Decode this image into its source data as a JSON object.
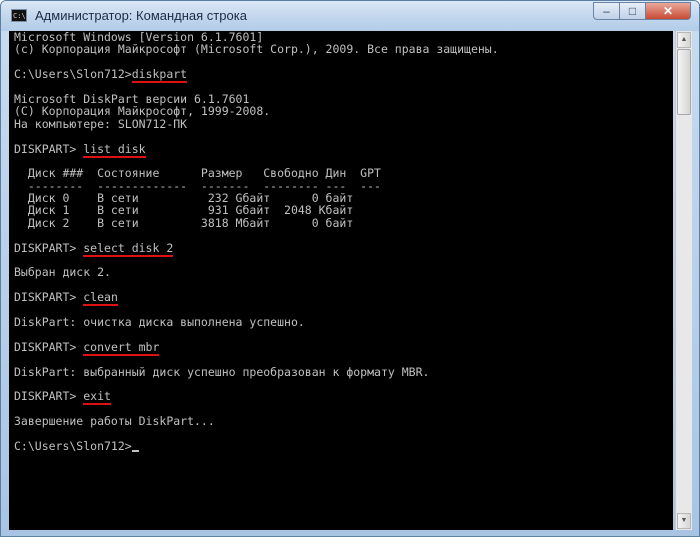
{
  "window": {
    "icon_text": "C:\\",
    "title": "Администратор: Командная строка",
    "minimize_glyph": "–",
    "maximize_glyph": "□",
    "close_glyph": "✕"
  },
  "console": {
    "lines": [
      {
        "pre": "Microsoft Windows [Version 6.1.7601]"
      },
      {
        "pre": "(c) Корпорация Майкрософт (Microsoft Corp.), 2009. Все права защищены."
      },
      {
        "pre": ""
      },
      {
        "pre": "C:\\Users\\Slon712>",
        "cmd": "diskpart"
      },
      {
        "pre": ""
      },
      {
        "pre": "Microsoft DiskPart версии 6.1.7601"
      },
      {
        "pre": "(C) Корпорация Майкрософт, 1999-2008."
      },
      {
        "pre": "На компьютере: SLON712-ПК"
      },
      {
        "pre": ""
      },
      {
        "pre": "DISKPART> ",
        "cmd": "list disk"
      },
      {
        "pre": ""
      },
      {
        "pre": "  Диск ###  Состояние      Размер   Свободно Дин  GPT"
      },
      {
        "pre": "  --------  -------------  -------  -------- ---  ---"
      },
      {
        "pre": "  Диск 0    В сети          232 Gбайт      0 байт"
      },
      {
        "pre": "  Диск 1    В сети          931 Gбайт  2048 Kбайт"
      },
      {
        "pre": "  Диск 2    В сети         3818 Mбайт      0 байт"
      },
      {
        "pre": ""
      },
      {
        "pre": "DISKPART> ",
        "cmd": "select disk 2"
      },
      {
        "pre": ""
      },
      {
        "pre": "Выбран диск 2."
      },
      {
        "pre": ""
      },
      {
        "pre": "DISKPART> ",
        "cmd": "clean"
      },
      {
        "pre": ""
      },
      {
        "pre": "DiskPart: очистка диска выполнена успешно."
      },
      {
        "pre": ""
      },
      {
        "pre": "DISKPART> ",
        "cmd": "convert mbr"
      },
      {
        "pre": ""
      },
      {
        "pre": "DiskPart: выбранный диск успешно преобразован к формату MBR."
      },
      {
        "pre": ""
      },
      {
        "pre": "DISKPART> ",
        "cmd": "exit"
      },
      {
        "pre": ""
      },
      {
        "pre": "Завершение работы DiskPart..."
      },
      {
        "pre": ""
      },
      {
        "pre": "C:\\Users\\Slon712>",
        "cursor": true
      }
    ]
  }
}
